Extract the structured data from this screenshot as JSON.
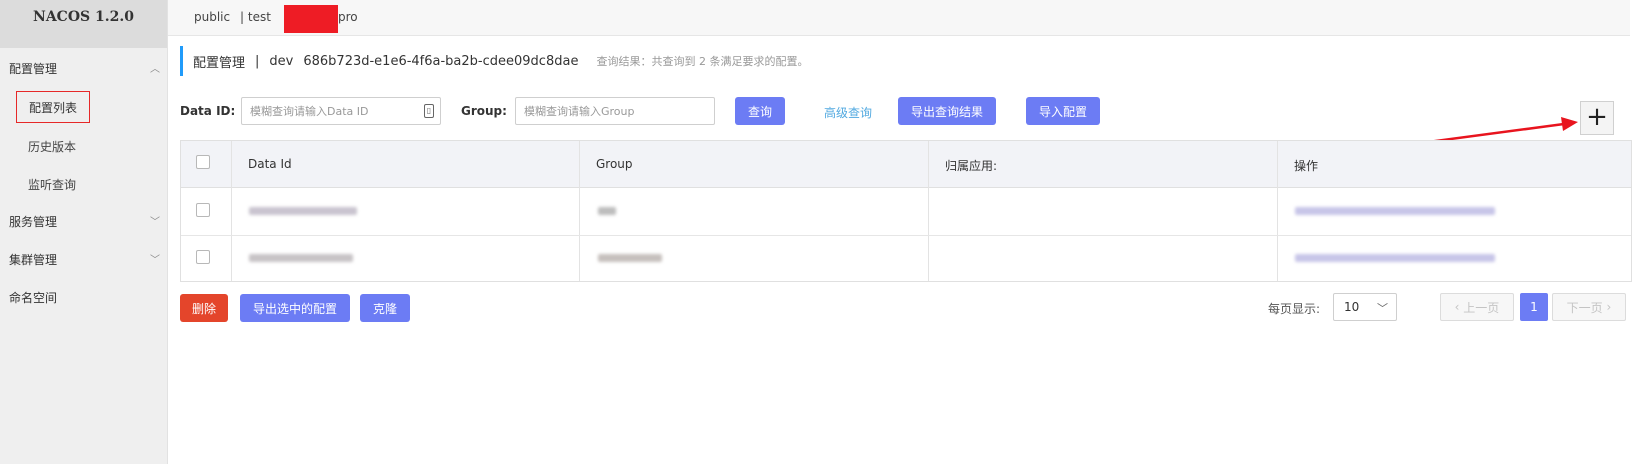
{
  "app": {
    "title": "NACOS 1.2.0"
  },
  "sidebar": {
    "groups": [
      {
        "label": "配置管理",
        "items": [
          "配置列表",
          "历史版本",
          "监听查询"
        ]
      },
      {
        "label": "服务管理"
      },
      {
        "label": "集群管理"
      },
      {
        "label": "命名空间"
      }
    ]
  },
  "namespaces": [
    "public",
    "| test",
    "pro"
  ],
  "header": {
    "title": "配置管理",
    "separator": "|",
    "namespace": "dev",
    "namespace_id": "686b723d-e1e6-4f6a-ba2b-cdee09dc8dae",
    "result": "查询结果：共查询到 2 条满足要求的配置。"
  },
  "search": {
    "data_id_label": "Data ID:",
    "data_id_placeholder": "模糊查询请输入Data ID",
    "group_label": "Group:",
    "group_placeholder": "模糊查询请输入Group",
    "query_button": "查询",
    "advanced_link": "高级查询",
    "export_results_button": "导出查询结果",
    "import_button": "导入配置"
  },
  "table": {
    "columns": [
      "Data Id",
      "Group",
      "归属应用:",
      "操作"
    ]
  },
  "footer": {
    "delete_button": "删除",
    "export_selected_button": "导出选中的配置",
    "clone_button": "克隆"
  },
  "pagination": {
    "per_page_label": "每页显示:",
    "per_page_value": "10",
    "prev": "上一页",
    "current": "1",
    "next": "下一页"
  },
  "colors": {
    "accent": "#6c7cf4",
    "danger": "#e4452b",
    "highlight": "#e62828"
  }
}
